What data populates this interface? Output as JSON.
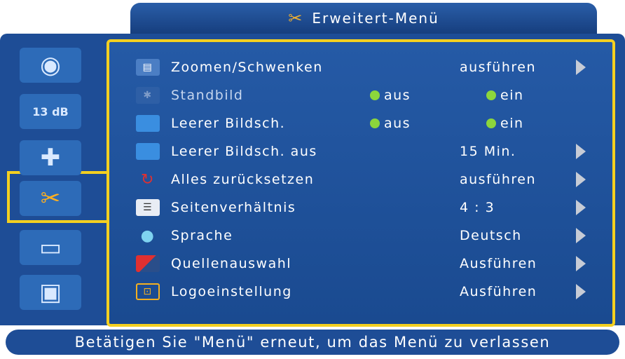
{
  "title": {
    "label": "Erweitert-Menü",
    "icon": "tools-icon"
  },
  "sidebar": {
    "items": [
      {
        "icon": "eye-icon"
      },
      {
        "icon": "audio-headphones-icon",
        "label": "13 dB"
      },
      {
        "icon": "ambulance-icon"
      },
      {
        "icon": "tools-icon",
        "active": true
      },
      {
        "icon": "projector-icon"
      },
      {
        "icon": "lock-icon"
      }
    ]
  },
  "menu": {
    "rows": [
      {
        "icon": "zoom-pan-icon",
        "label": "Zoomen/Schwenken",
        "value": "ausführen",
        "arrow": true
      },
      {
        "icon": "freeze-icon",
        "label": "Standbild",
        "opt1": "aus",
        "opt2": "ein",
        "dim": true
      },
      {
        "icon": "blank-screen-icon",
        "label": "Leerer Bildsch.",
        "opt1": "aus",
        "opt2": "ein"
      },
      {
        "icon": "blank-screen-off-icon",
        "label": "Leerer Bildsch. aus",
        "value": "15 Min.",
        "arrow": true
      },
      {
        "icon": "reset-icon",
        "label": "Alles zurücksetzen",
        "value": "ausführen",
        "arrow": true
      },
      {
        "icon": "aspect-ratio-icon",
        "label": "Seitenverhältnis",
        "value": "4 : 3",
        "arrow": true
      },
      {
        "icon": "language-icon",
        "label": "Sprache",
        "value": "Deutsch",
        "arrow": true
      },
      {
        "icon": "source-select-icon",
        "label": "Quellenauswahl",
        "value": "Ausführen",
        "arrow": true
      },
      {
        "icon": "logo-settings-icon",
        "label": "Logoeinstellung",
        "value": "Ausführen",
        "arrow": true
      }
    ]
  },
  "footer": {
    "text": "Betätigen Sie \"Menü\" erneut, um das Menü zu verlassen"
  },
  "colors": {
    "panel": "#1e4d96",
    "highlight": "#f4d020",
    "radio": "#8cd63c"
  }
}
